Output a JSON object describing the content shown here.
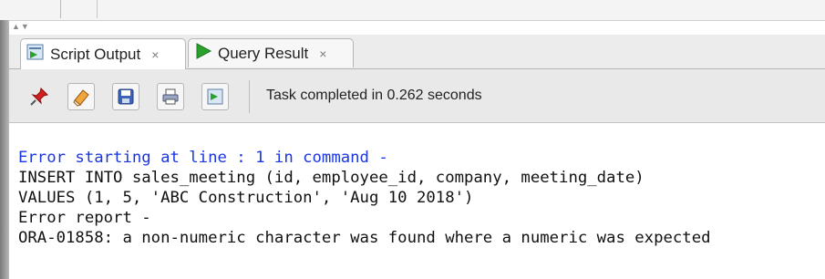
{
  "tabs": [
    {
      "label": "Script Output",
      "close": "×",
      "icon": "script-output-icon",
      "active": true
    },
    {
      "label": "Query Result",
      "close": "×",
      "icon": "run-triangle-icon",
      "active": false
    }
  ],
  "toolbar": {
    "buttons": [
      "pin-icon",
      "eraser-icon",
      "save-icon",
      "print-icon",
      "export-icon"
    ],
    "status": "Task completed in 0.262 seconds"
  },
  "output": {
    "error_header": "Error starting at line : 1 in command -",
    "lines": [
      "INSERT INTO sales_meeting (id, employee_id, company, meeting_date)",
      "VALUES (1, 5, 'ABC Construction', 'Aug 10 2018')",
      "Error report -",
      "ORA-01858: a non-numeric character was found where a numeric was expected"
    ]
  },
  "colors": {
    "error_blue": "#1a36e0",
    "run_green": "#2aa12a"
  }
}
